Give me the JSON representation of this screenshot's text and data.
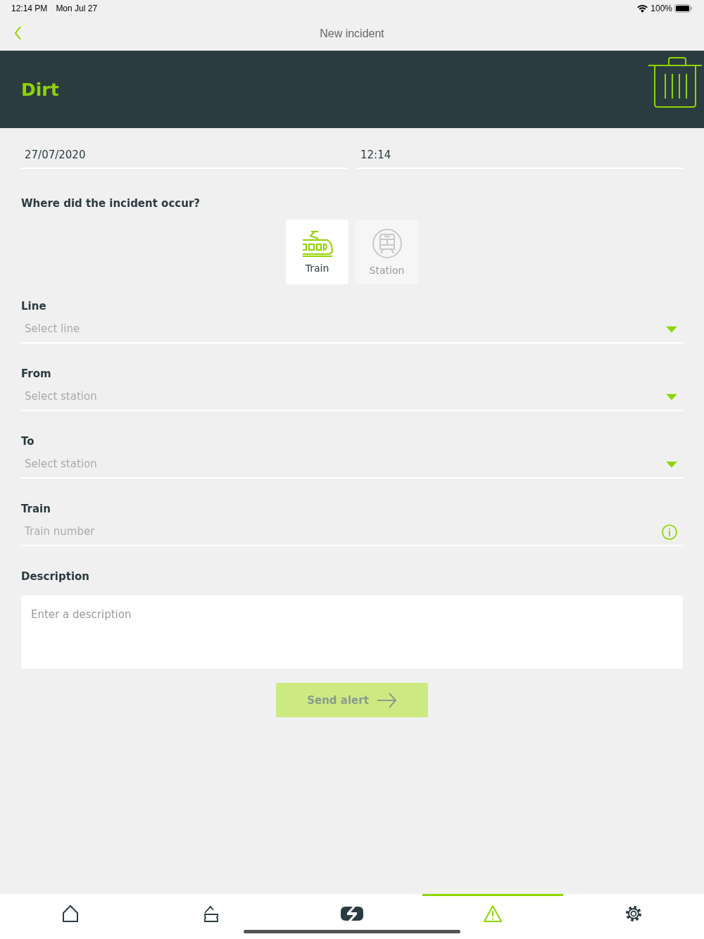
{
  "status_bar": {
    "time": "12:14 PM",
    "date": "Mon Jul 27",
    "battery": "100%"
  },
  "nav": {
    "title": "New incident"
  },
  "header": {
    "title": "Dirt"
  },
  "date_field": {
    "value": "27/07/2020"
  },
  "time_field": {
    "value": "12:14"
  },
  "location": {
    "question": "Where did the incident occur?",
    "options": [
      {
        "label": "Train",
        "kind": "train",
        "selected": true
      },
      {
        "label": "Station",
        "kind": "station",
        "selected": false
      }
    ]
  },
  "fields": [
    {
      "label": "Line",
      "placeholder": "Select line",
      "kind": "select"
    },
    {
      "label": "From",
      "placeholder": "Select station",
      "kind": "select"
    },
    {
      "label": "To",
      "placeholder": "Select station",
      "kind": "select"
    },
    {
      "label": "Train",
      "placeholder": "Train number",
      "kind": "info"
    }
  ],
  "description": {
    "label": "Description",
    "placeholder": "Enter a description"
  },
  "send_button": {
    "label": "Send alert",
    "disabled": true
  },
  "tab_bar": [
    {
      "kind": "home",
      "selected": false
    },
    {
      "kind": "ticket",
      "selected": false
    },
    {
      "kind": "link",
      "selected": false
    },
    {
      "kind": "alert",
      "selected": true
    },
    {
      "kind": "settings",
      "selected": false
    }
  ]
}
